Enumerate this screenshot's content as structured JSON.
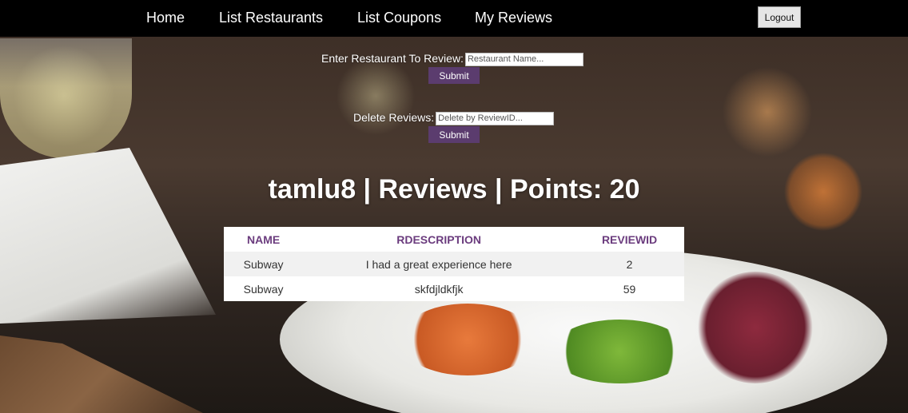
{
  "navbar": {
    "links": [
      {
        "label": "Home"
      },
      {
        "label": "List Restaurants"
      },
      {
        "label": "List Coupons"
      },
      {
        "label": "My Reviews"
      }
    ],
    "logout_label": "Logout"
  },
  "review_form": {
    "label": "Enter Restaurant To Review:",
    "placeholder": "Restaurant Name...",
    "value": "",
    "submit_label": "Submit"
  },
  "delete_form": {
    "label": "Delete Reviews:",
    "placeholder": "Delete by ReviewID...",
    "value": "",
    "submit_label": "Submit"
  },
  "page_title": "tamlu8 | Reviews | Points: 20",
  "reviews_table": {
    "headers": [
      "NAME",
      "RDESCRIPTION",
      "REVIEWID"
    ],
    "rows": [
      [
        "Subway",
        "I had a great experience here",
        "2"
      ],
      [
        "Subway",
        "skfdjldkfjk",
        "59"
      ]
    ]
  },
  "colors": {
    "navbar": "#000000",
    "accent": "#5b3c6e",
    "header_text": "#6b3c7e"
  }
}
